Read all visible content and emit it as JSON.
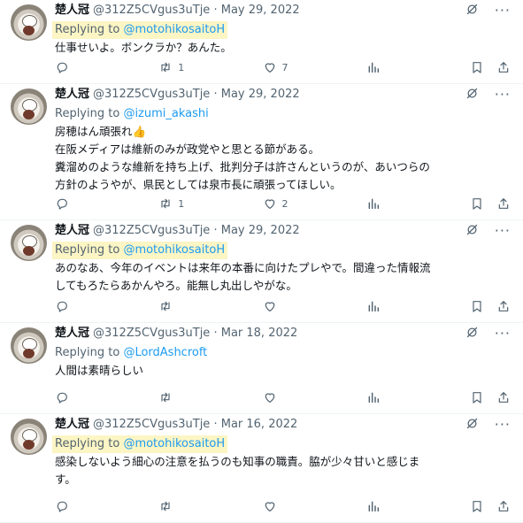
{
  "tweets": [
    {
      "name": "楚人冠",
      "handle": "@312Z5CVgus3uTje",
      "sep": "·",
      "date": "May 29, 2022",
      "reply_prefix": "Replying to ",
      "reply_to": "@motohikosaitoH",
      "reply_highlight": true,
      "lines": [
        "仕事せいよ。ボンクラか？あんた。"
      ],
      "retweets": "1",
      "likes": "7"
    },
    {
      "name": "楚人冠",
      "handle": "@312Z5CVgus3uTje",
      "sep": "·",
      "date": "May 29, 2022",
      "reply_prefix": "Replying to ",
      "reply_to": "@izumi_akashi",
      "reply_highlight": false,
      "lines": [
        "房穂はん頑張れ👍",
        "在阪メディアは維新のみが政党やと思とる節がある。",
        "糞溜めのような維新を持ち上げ、批判分子は許さんというのが、あいつらの",
        "方針のようやが、県民としては泉市長に頑張ってほしい。"
      ],
      "retweets": "1",
      "likes": "2"
    },
    {
      "name": "楚人冠",
      "handle": "@312Z5CVgus3uTje",
      "sep": "·",
      "date": "May 29, 2022",
      "reply_prefix": "Replying to ",
      "reply_to": "@motohikosaitoH",
      "reply_highlight": true,
      "lines": [
        "あのなあ、今年のイベントは来年の本番に向けたプレやで。間違った情報流",
        "してもろたらあかんやろ。能無し丸出しやがな。"
      ],
      "retweets": "",
      "likes": ""
    },
    {
      "name": "楚人冠",
      "handle": "@312Z5CVgus3uTje",
      "sep": "·",
      "date": "Mar 18, 2022",
      "reply_prefix": "Replying to ",
      "reply_to": "@LordAshcroft",
      "reply_highlight": false,
      "lines": [
        "人間は素晴らしい"
      ],
      "retweets": "",
      "likes": ""
    },
    {
      "name": "楚人冠",
      "handle": "@312Z5CVgus3uTje",
      "sep": "·",
      "date": "Mar 16, 2022",
      "reply_prefix": "Replying to ",
      "reply_to": "@motohikosaitoH",
      "reply_highlight": true,
      "lines": [
        "感染しないよう細心の注意を払うのも知事の職責。脇が少々甘いと感じま",
        "す。"
      ],
      "retweets": "",
      "likes": ""
    }
  ],
  "icons": {
    "reply": "reply-icon",
    "retweet": "retweet-icon",
    "like": "heart-icon",
    "views": "analytics-icon",
    "bookmark": "bookmark-icon",
    "share": "share-icon",
    "grok": "grok-icon",
    "more": "more-icon"
  },
  "colors": {
    "link": "#1d9bf0",
    "secondary": "#536471",
    "highlight": "#fcf5c4"
  }
}
